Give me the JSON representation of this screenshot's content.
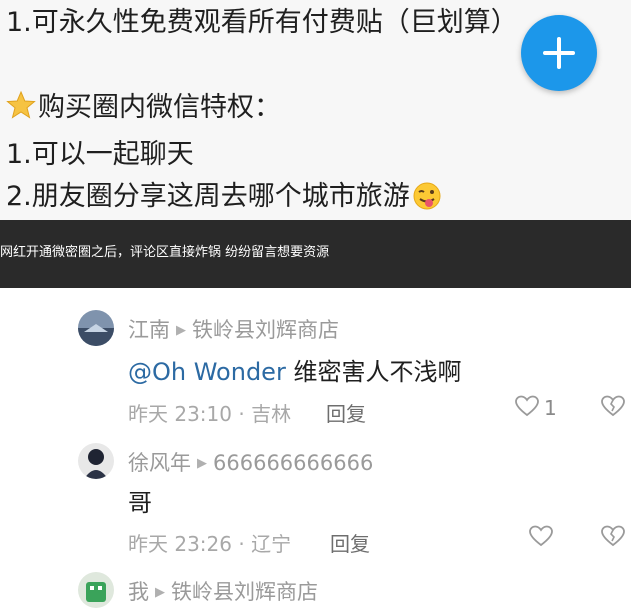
{
  "post": {
    "lines": [
      "1.可永久性免费观看所有付费贴（巨划算）",
      "购买圈内微信特权：",
      "1.可以一起聊天",
      "2.朋友圈分享这周去哪个城市旅游"
    ],
    "fab_icon": "plus-icon"
  },
  "banner": {
    "caption": "网红开通微密圈之后，评论区直接炸锅 纷纷留言想要资源"
  },
  "comments": [
    {
      "user": "江南",
      "reply_to": "铁岭县刘辉商店",
      "mention": "@Oh Wonder",
      "text": " 维密害人不浅啊",
      "time_location": "昨天 23:10 · 吉林",
      "reply_label": "回复",
      "likes": "1"
    },
    {
      "user": "徐风年",
      "reply_to": "666666666666",
      "mention": "",
      "text": "哥",
      "time_location": "昨天 23:26 · 辽宁",
      "reply_label": "回复",
      "likes": ""
    },
    {
      "user": "我",
      "reply_to": "铁岭县刘辉商店"
    }
  ],
  "colors": {
    "fab": "#1c97ea",
    "mention": "#2c6aa3",
    "banner_bg": "#2a2a2a"
  }
}
